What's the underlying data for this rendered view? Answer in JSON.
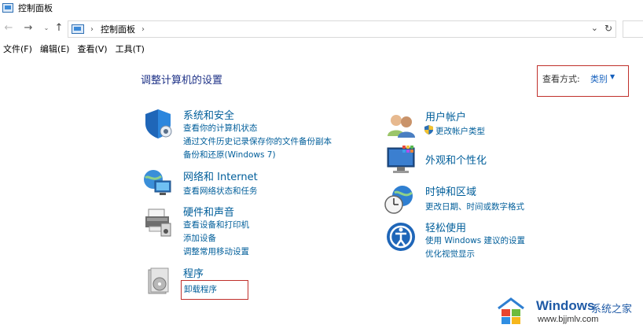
{
  "window": {
    "title": "控制面板"
  },
  "nav": {
    "back_glyph": "←",
    "forward_glyph": "→",
    "recent_glyph": "⌄",
    "up_glyph": "↑",
    "breadcrumb_sep": "›",
    "location": "控制面板",
    "dropdown_glyph": "⌄",
    "refresh_glyph": "↻"
  },
  "menu": {
    "items": [
      {
        "label": "文件(F)"
      },
      {
        "label": "编辑(E)"
      },
      {
        "label": "查看(V)"
      },
      {
        "label": "工具(T)"
      }
    ]
  },
  "main": {
    "heading": "调整计算机的设置",
    "view_by": {
      "label": "查看方式:",
      "value": "类别",
      "arrow": "▼"
    }
  },
  "categories": {
    "system_security": {
      "title": "系统和安全",
      "links": [
        "查看你的计算机状态",
        "通过文件历史记录保存你的文件备份副本",
        "备份和还原(Windows 7)"
      ]
    },
    "network": {
      "title": "网络和 Internet",
      "links": [
        "查看网络状态和任务"
      ]
    },
    "hardware": {
      "title": "硬件和声音",
      "links": [
        "查看设备和打印机",
        "添加设备",
        "调整常用移动设置"
      ]
    },
    "programs": {
      "title": "程序",
      "links": [
        "卸载程序"
      ]
    },
    "user_accounts": {
      "title": "用户帐户",
      "links": [
        "更改帐户类型"
      ]
    },
    "appearance": {
      "title": "外观和个性化",
      "links": []
    },
    "clock_region": {
      "title": "时钟和区域",
      "links": [
        "更改日期、时间或数字格式"
      ]
    },
    "ease_access": {
      "title": "轻松使用",
      "links": [
        "使用 Windows 建议的设置",
        "优化视觉显示"
      ]
    }
  },
  "watermark": {
    "brand": "Windows",
    "site_name": "系统之家",
    "url": "www.bjjmlv.com"
  },
  "colors": {
    "link": "#005e9a",
    "heading": "#1e3287",
    "highlight_box": "#c0302b"
  },
  "icons": {
    "system_security": "shield-icon",
    "network": "network-globe-icon",
    "hardware": "printer-icon",
    "programs": "programs-disc-icon",
    "user_accounts": "users-icon",
    "appearance": "monitor-color-icon",
    "clock_region": "clock-globe-icon",
    "ease_access": "ease-of-access-icon"
  }
}
